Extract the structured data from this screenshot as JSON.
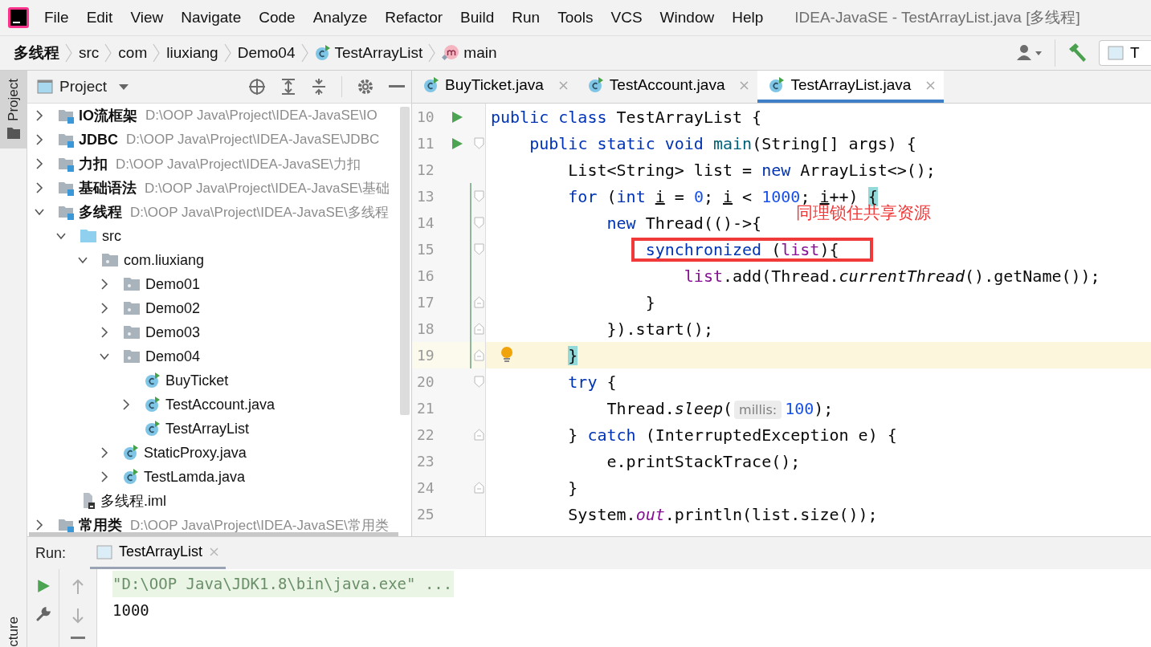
{
  "menu": [
    "File",
    "Edit",
    "View",
    "Navigate",
    "Code",
    "Analyze",
    "Refactor",
    "Build",
    "Run",
    "Tools",
    "VCS",
    "Window",
    "Help"
  ],
  "window": {
    "title": "IDEA-JavaSE - TestArrayList.java [多线程]"
  },
  "breadcrumb": [
    {
      "label": "多线程",
      "kind": "module"
    },
    {
      "label": "src",
      "kind": "folder"
    },
    {
      "label": "com",
      "kind": "folder"
    },
    {
      "label": "liuxiang",
      "kind": "folder"
    },
    {
      "label": "Demo04",
      "kind": "folder"
    },
    {
      "label": "TestArrayList",
      "kind": "class"
    },
    {
      "label": "main",
      "kind": "method"
    }
  ],
  "run_config": "T",
  "side_stripe": {
    "top": {
      "label": "Project",
      "selected": true
    },
    "bottom": {
      "label": "cture",
      "selected": false
    }
  },
  "project_panel": {
    "title": "Project",
    "tree": [
      {
        "label": "IO流框架",
        "kind": "module",
        "path": "D:\\OOP Java\\Project\\IDEA-JavaSE\\IO",
        "expanded": false
      },
      {
        "label": "JDBC",
        "kind": "module",
        "path": "D:\\OOP Java\\Project\\IDEA-JavaSE\\JDBC",
        "expanded": false
      },
      {
        "label": "力扣",
        "kind": "module",
        "path": "D:\\OOP Java\\Project\\IDEA-JavaSE\\力扣",
        "expanded": false
      },
      {
        "label": "基础语法",
        "kind": "module",
        "path": "D:\\OOP Java\\Project\\IDEA-JavaSE\\基础",
        "expanded": false
      },
      {
        "label": "多线程",
        "kind": "module",
        "path": "D:\\OOP Java\\Project\\IDEA-JavaSE\\多线程",
        "expanded": true,
        "children": [
          {
            "label": "src",
            "kind": "source-folder",
            "expanded": true,
            "children": [
              {
                "label": "com.liuxiang",
                "kind": "package",
                "expanded": true,
                "children": [
                  {
                    "label": "Demo01",
                    "kind": "package",
                    "expanded": false
                  },
                  {
                    "label": "Demo02",
                    "kind": "package",
                    "expanded": false
                  },
                  {
                    "label": "Demo03",
                    "kind": "package",
                    "expanded": false
                  },
                  {
                    "label": "Demo04",
                    "kind": "package",
                    "expanded": true,
                    "children": [
                      {
                        "label": "BuyTicket",
                        "kind": "class"
                      },
                      {
                        "label": "TestAccount.java",
                        "kind": "class",
                        "expanded": false
                      },
                      {
                        "label": "TestArrayList",
                        "kind": "class"
                      }
                    ]
                  },
                  {
                    "label": "StaticProxy.java",
                    "kind": "class",
                    "expanded": false
                  },
                  {
                    "label": "TestLamda.java",
                    "kind": "class",
                    "expanded": false
                  }
                ]
              }
            ]
          },
          {
            "label": "多线程.iml",
            "kind": "iml"
          }
        ]
      },
      {
        "label": "常用类",
        "kind": "module",
        "path": "D:\\OOP Java\\Project\\IDEA-JavaSE\\常用类",
        "expanded": false
      }
    ]
  },
  "editor_tabs": [
    {
      "label": "BuyTicket.java",
      "selected": false
    },
    {
      "label": "TestAccount.java",
      "selected": false
    },
    {
      "label": "TestArrayList.java",
      "selected": true
    }
  ],
  "code_lines": [
    {
      "number": "10",
      "boxed": false,
      "run": true,
      "fold_open": false,
      "fold_close": false,
      "changed": false,
      "current": false,
      "bulb": false,
      "tokens": [
        {
          "kind": "keyword",
          "text": "public class"
        },
        {
          "kind": "plain",
          "text": " TestArrayList {"
        }
      ]
    },
    {
      "number": "11",
      "boxed": false,
      "run": true,
      "fold_open": true,
      "fold_close": false,
      "changed": false,
      "current": false,
      "bulb": false,
      "tokens": [
        {
          "kind": "keyword",
          "text": "    public static void"
        },
        {
          "kind": "declaration",
          "text": " main"
        },
        {
          "kind": "plain",
          "text": "(String[] args) {"
        }
      ]
    },
    {
      "number": "12",
      "boxed": false,
      "run": false,
      "fold_open": false,
      "fold_close": false,
      "changed": false,
      "current": false,
      "bulb": false,
      "tokens": [
        {
          "kind": "plain",
          "text": "        List<String> list = "
        },
        {
          "kind": "keyword",
          "text": "new"
        },
        {
          "kind": "plain",
          "text": " ArrayList<>();"
        }
      ]
    },
    {
      "number": "13",
      "boxed": false,
      "run": false,
      "fold_open": true,
      "fold_close": false,
      "changed": true,
      "current": false,
      "bulb": false,
      "tokens": [
        {
          "kind": "keyword",
          "text": "        for"
        },
        {
          "kind": "plain",
          "text": " ("
        },
        {
          "kind": "keyword",
          "text": "int "
        },
        {
          "kind": "reassigned",
          "text": "i"
        },
        {
          "kind": "plain",
          "text": " = "
        },
        {
          "kind": "number",
          "text": "0"
        },
        {
          "kind": "plain",
          "text": "; "
        },
        {
          "kind": "reassigned",
          "text": "i"
        },
        {
          "kind": "plain",
          "text": " < "
        },
        {
          "kind": "number",
          "text": "1000"
        },
        {
          "kind": "plain",
          "text": "; "
        },
        {
          "kind": "reassigned",
          "text": "i"
        },
        {
          "kind": "plain",
          "text": "++) "
        },
        {
          "kind": "brace-match",
          "text": "{"
        }
      ]
    },
    {
      "number": "14",
      "boxed": false,
      "run": false,
      "fold_open": true,
      "fold_close": false,
      "changed": true,
      "current": false,
      "bulb": false,
      "tokens": [
        {
          "kind": "keyword",
          "text": "            new"
        },
        {
          "kind": "plain",
          "text": " Thread(()->{"
        }
      ]
    },
    {
      "number": "15",
      "run": false,
      "fold_open": true,
      "fold_close": false,
      "changed": true,
      "current": false,
      "bulb": false,
      "boxed": true,
      "tokens": [
        {
          "kind": "keyword",
          "text": "                synchronized"
        },
        {
          "kind": "plain",
          "text": " ("
        },
        {
          "kind": "field",
          "text": "list"
        },
        {
          "kind": "plain",
          "text": "){"
        }
      ]
    },
    {
      "number": "16",
      "boxed": false,
      "run": false,
      "fold_open": false,
      "fold_close": false,
      "changed": true,
      "current": false,
      "bulb": false,
      "tokens": [
        {
          "kind": "field",
          "text": "                    list"
        },
        {
          "kind": "plain",
          "text": ".add(Thread."
        },
        {
          "kind": "static",
          "text": "currentThread"
        },
        {
          "kind": "plain",
          "text": "().getName());"
        }
      ]
    },
    {
      "number": "17",
      "boxed": false,
      "run": false,
      "fold_open": false,
      "fold_close": true,
      "changed": true,
      "current": false,
      "bulb": false,
      "tokens": [
        {
          "kind": "plain",
          "text": "                }"
        }
      ]
    },
    {
      "number": "18",
      "boxed": false,
      "run": false,
      "fold_open": false,
      "fold_close": true,
      "changed": true,
      "current": false,
      "bulb": false,
      "tokens": [
        {
          "kind": "plain",
          "text": "            }).start();"
        }
      ]
    },
    {
      "number": "19",
      "boxed": false,
      "run": false,
      "fold_open": false,
      "fold_close": true,
      "changed": true,
      "current": true,
      "bulb": true,
      "tokens": [
        {
          "kind": "brace-match",
          "text": "        }"
        }
      ]
    },
    {
      "number": "20",
      "boxed": false,
      "run": false,
      "fold_open": true,
      "fold_close": false,
      "changed": false,
      "current": false,
      "bulb": false,
      "tokens": [
        {
          "kind": "keyword",
          "text": "        try"
        },
        {
          "kind": "plain",
          "text": " {"
        }
      ]
    },
    {
      "number": "21",
      "boxed": false,
      "run": false,
      "fold_open": false,
      "fold_close": false,
      "changed": false,
      "current": false,
      "bulb": false,
      "tokens": [
        {
          "kind": "plain",
          "text": "            Thread."
        },
        {
          "kind": "static",
          "text": "sleep"
        },
        {
          "kind": "plain",
          "text": "("
        },
        {
          "kind": "hint",
          "text": "millis:"
        },
        {
          "kind": "number",
          "text": "100"
        },
        {
          "kind": "plain",
          "text": ");"
        }
      ]
    },
    {
      "number": "22",
      "boxed": false,
      "run": false,
      "fold_open": false,
      "fold_close": true,
      "changed": false,
      "current": false,
      "bulb": false,
      "tokens": [
        {
          "kind": "plain",
          "text": "        } "
        },
        {
          "kind": "keyword",
          "text": "catch"
        },
        {
          "kind": "plain",
          "text": " (InterruptedException e) {"
        }
      ]
    },
    {
      "number": "23",
      "boxed": false,
      "run": false,
      "fold_open": false,
      "fold_close": false,
      "changed": false,
      "current": false,
      "bulb": false,
      "tokens": [
        {
          "kind": "plain",
          "text": "            e.printStackTrace();"
        }
      ]
    },
    {
      "number": "24",
      "boxed": false,
      "run": false,
      "fold_open": false,
      "fold_close": true,
      "changed": false,
      "current": false,
      "bulb": false,
      "tokens": [
        {
          "kind": "plain",
          "text": "        }"
        }
      ]
    },
    {
      "number": "25",
      "boxed": false,
      "run": false,
      "fold_open": false,
      "fold_close": false,
      "changed": false,
      "current": false,
      "bulb": false,
      "tokens": [
        {
          "kind": "plain",
          "text": "        System."
        },
        {
          "kind": "static-field",
          "text": "out"
        },
        {
          "kind": "plain",
          "text": ".println(list.size());"
        }
      ]
    }
  ],
  "annotation": {
    "text": "同理锁住共享资源"
  },
  "run_panel": {
    "label": "Run:",
    "tab": {
      "label": "TestArrayList",
      "selected": true
    },
    "output": [
      {
        "kind": "command",
        "text": "\"D:\\OOP Java\\JDK1.8\\bin\\java.exe\" ..."
      },
      {
        "kind": "stdout",
        "text": "1000"
      }
    ]
  }
}
